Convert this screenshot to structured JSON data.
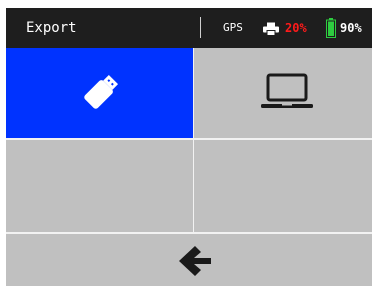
{
  "header": {
    "title": "Export",
    "gps_label": "GPS",
    "printer_percent": "20%",
    "battery_percent": "90%",
    "printer_level": 0.2,
    "battery_level": 0.9
  },
  "tiles": [
    {
      "name": "usb-export",
      "icon": "usb-icon",
      "selected": true
    },
    {
      "name": "computer-export",
      "icon": "laptop-icon",
      "selected": false
    },
    {
      "name": "empty-left",
      "selected": false
    },
    {
      "name": "empty-right",
      "selected": false
    }
  ],
  "footer": {
    "back_icon": "back-arrow-icon"
  },
  "colors": {
    "status_bar_bg": "#1e1e1e",
    "selected_tile": "#0033ff",
    "tile_bg": "#c0c0c0",
    "low_printer": "#ff1a1a",
    "battery": "#2ecc40",
    "icon_dark": "#1a1a1a"
  }
}
